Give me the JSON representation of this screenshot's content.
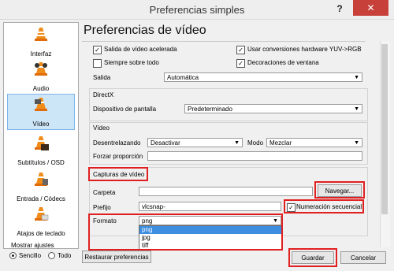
{
  "window": {
    "title": "Preferencias simples",
    "help": "?",
    "close": "✕"
  },
  "sidebar": {
    "items": [
      {
        "label": "Interfaz",
        "icon": "interface-cone-icon"
      },
      {
        "label": "Audio",
        "icon": "audio-cone-icon"
      },
      {
        "label": "Vídeo",
        "icon": "video-cone-icon",
        "active": true
      },
      {
        "label": "Subtítulos / OSD",
        "icon": "subtitles-cone-icon"
      },
      {
        "label": "Entrada / Códecs",
        "icon": "input-codecs-cone-icon"
      },
      {
        "label": "Atajos de teclado",
        "icon": "hotkeys-cone-icon"
      }
    ]
  },
  "show_settings": {
    "label": "Mostrar ajustes",
    "simple": "Sencillo",
    "all": "Todo",
    "selected": "Sencillo"
  },
  "main": {
    "title": "Preferencias de vídeo",
    "accelerated": {
      "label": "Salida de vídeo acelerada",
      "checked": true
    },
    "hw_yuv": {
      "label": "Usar conversiones hardware YUV->RGB",
      "checked": true
    },
    "always_on_top": {
      "label": "Siempre sobre todo",
      "checked": false
    },
    "window_decorations": {
      "label": "Decoraciones de ventana",
      "checked": true
    },
    "output": {
      "label": "Salida",
      "value": "Automática"
    },
    "directx": {
      "heading": "DirectX",
      "display_label": "Dispositivo de pantalla",
      "display_value": "Predeterminado"
    },
    "video": {
      "heading": "Vídeo",
      "deinterlace_label": "Desentrelazando",
      "deinterlace_value": "Desactivar",
      "mode_label": "Modo",
      "mode_value": "Mezclar",
      "force_ratio_label": "Forzar proporción",
      "force_ratio_value": ""
    },
    "snapshots": {
      "heading": "Capturas de vídeo",
      "folder_label": "Carpeta",
      "folder_value": "",
      "browse": "Navegar...",
      "prefix_label": "Prefijo",
      "prefix_value": "vlcsnap-",
      "sequential": {
        "label": "Numeración secuencial",
        "checked": true
      },
      "format_label": "Formato",
      "format_value": "png",
      "format_options": [
        "png",
        "jpg",
        "tiff"
      ],
      "format_highlighted": "png"
    }
  },
  "footer": {
    "reset": "Restaurar preferencias",
    "save": "Guardar",
    "cancel": "Cancelar"
  },
  "colors": {
    "highlight": "#e02020",
    "selection": "#3d8ee0",
    "active_item": "#cde6f7",
    "close": "#c7403a"
  }
}
